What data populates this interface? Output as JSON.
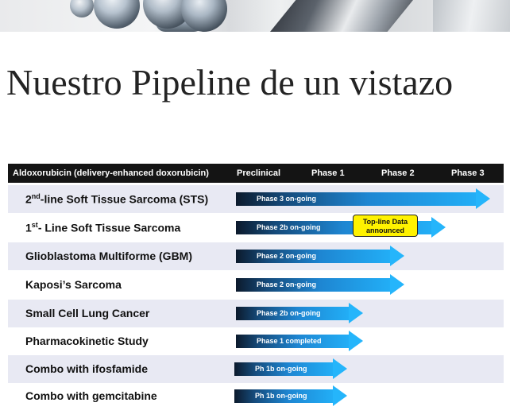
{
  "title": "Nuestro Pipeline de un vistazo",
  "table": {
    "headers": [
      "Aldoxorubicin (delivery-enhanced doxorubicin)",
      "Preclinical",
      "Phase 1",
      "Phase 2",
      "Phase 3"
    ],
    "rows": [
      {
        "label_pre": "2",
        "label_sup": "nd",
        "label_post": "-line Soft Tissue Sarcoma (STS)",
        "status": "Phase 3 on-going"
      },
      {
        "label_pre": "1",
        "label_sup": "st",
        "label_post": "- Line Soft Tissue Sarcoma",
        "status": "Phase 2b  on-going"
      },
      {
        "label": "Glioblastoma  Multiforme (GBM)",
        "status": "Phase 2  on-going"
      },
      {
        "label": "Kaposi’s Sarcoma",
        "status": "Phase 2  on-going"
      },
      {
        "label": "Small Cell Lung Cancer",
        "status": "Phase 2b on-going"
      },
      {
        "label": "Pharmacokinetic Study",
        "status": "Phase 1 completed"
      },
      {
        "label": "Combo with ifosfamide",
        "status": "Ph 1b on-going"
      },
      {
        "label": "Combo with gemcitabine",
        "status": "Ph 1b on-going"
      }
    ]
  },
  "callout": {
    "line1": "Top-line Data",
    "line2": "announced"
  },
  "colors": {
    "header_bg": "#141414",
    "row_alt": "#e8e9f3",
    "arrow": "#22aef6",
    "callout": "#fff200"
  }
}
